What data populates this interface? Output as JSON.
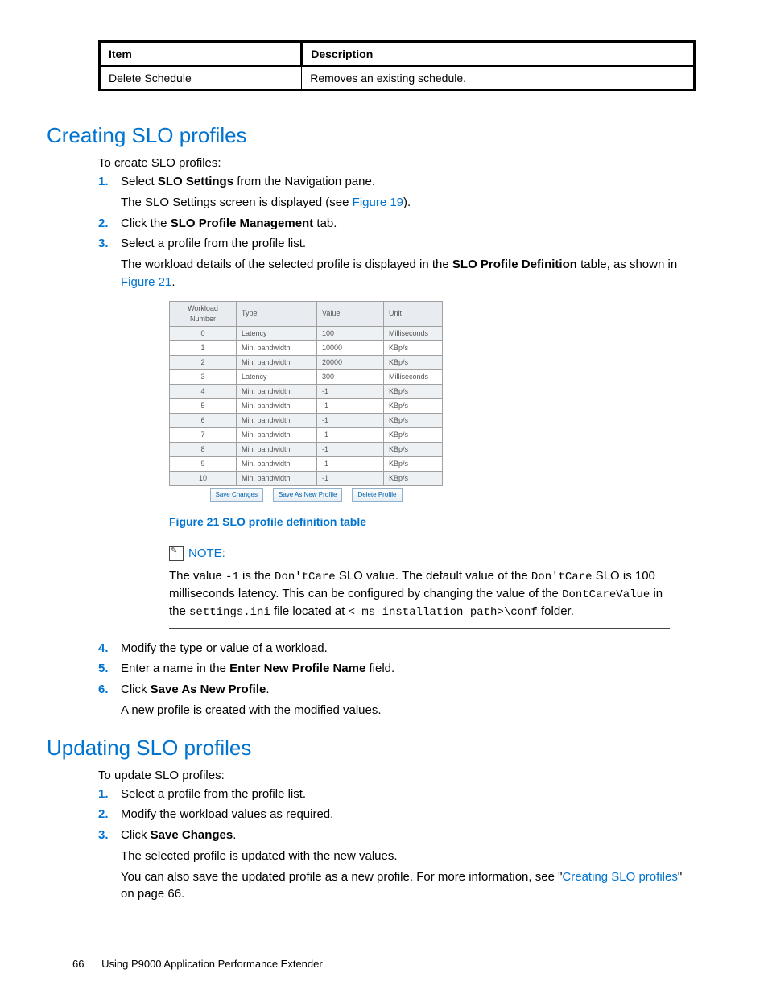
{
  "top_table": {
    "headers": {
      "c1": "Item",
      "c2": "Description"
    },
    "rows": [
      {
        "c1": "Delete Schedule",
        "c2": "Removes an existing schedule."
      }
    ]
  },
  "section1": {
    "title": "Creating SLO profiles",
    "intro": "To create SLO profiles:",
    "steps": {
      "s1a": "Select ",
      "s1b": "SLO Settings",
      "s1c": " from the Navigation pane.",
      "s1d": "The SLO Settings screen is displayed (see ",
      "s1e": "Figure 19",
      "s1f": ").",
      "s2a": "Click the ",
      "s2b": "SLO Profile Management",
      "s2c": " tab.",
      "s3a": "Select a profile from the profile list.",
      "s3b": "The workload details of the selected profile is displayed in the ",
      "s3c": "SLO Profile Definition",
      "s3d": " table, as shown in ",
      "s3e": "Figure 21",
      "s3f": ".",
      "s4": "Modify the type or value of a workload.",
      "s5a": "Enter a name in the ",
      "s5b": "Enter New Profile Name",
      "s5c": " field.",
      "s6a": "Click ",
      "s6b": "Save As New Profile",
      "s6c": ".",
      "s6d": "A new profile is created with the modified values."
    }
  },
  "chart_data": {
    "type": "table",
    "title": "Figure 21 SLO profile definition table",
    "headers": [
      "Workload Number",
      "Type",
      "Value",
      "Unit"
    ],
    "rows": [
      [
        "0",
        "Latency",
        "100",
        "Milliseconds"
      ],
      [
        "1",
        "Min. bandwidth",
        "10000",
        "KBp/s"
      ],
      [
        "2",
        "Min. bandwidth",
        "20000",
        "KBp/s"
      ],
      [
        "3",
        "Latency",
        "300",
        "Milliseconds"
      ],
      [
        "4",
        "Min. bandwidth",
        "-1",
        "KBp/s"
      ],
      [
        "5",
        "Min. bandwidth",
        "-1",
        "KBp/s"
      ],
      [
        "6",
        "Min. bandwidth",
        "-1",
        "KBp/s"
      ],
      [
        "7",
        "Min. bandwidth",
        "-1",
        "KBp/s"
      ],
      [
        "8",
        "Min. bandwidth",
        "-1",
        "KBp/s"
      ],
      [
        "9",
        "Min. bandwidth",
        "-1",
        "KBp/s"
      ],
      [
        "10",
        "Min. bandwidth",
        "-1",
        "KBp/s"
      ]
    ],
    "buttons": [
      "Save Changes",
      "Save As New Profile",
      "Delete Profile"
    ]
  },
  "note": {
    "label": "NOTE:",
    "t1": "The value ",
    "t2": "-1",
    "t3": " is the ",
    "t4": "Don'tCare",
    "t5": " SLO value. The default value of the ",
    "t6": "Don'tCare",
    "t7": " SLO is 100 milliseconds latency. This can be configured by changing the value of the ",
    "t8": "DontCareValue",
    "t9": " in the ",
    "t10": "settings.ini",
    "t11": " file located at ",
    "t12": "< ms installation path>\\conf",
    "t13": " folder."
  },
  "section2": {
    "title": "Updating SLO profiles",
    "intro": "To update SLO profiles:",
    "steps": {
      "s1": "Select a profile from the profile list.",
      "s2": "Modify the workload values as required.",
      "s3a": "Click ",
      "s3b": "Save Changes",
      "s3c": ".",
      "s3d": "The selected profile is updated with the new values.",
      "s3e": "You can also save the updated profile as a new profile. For more information, see \"",
      "s3f": "Creating SLO profiles",
      "s3g": "\" on page 66."
    }
  },
  "footer": {
    "page": "66",
    "text": "Using P9000 Application Performance Extender"
  }
}
